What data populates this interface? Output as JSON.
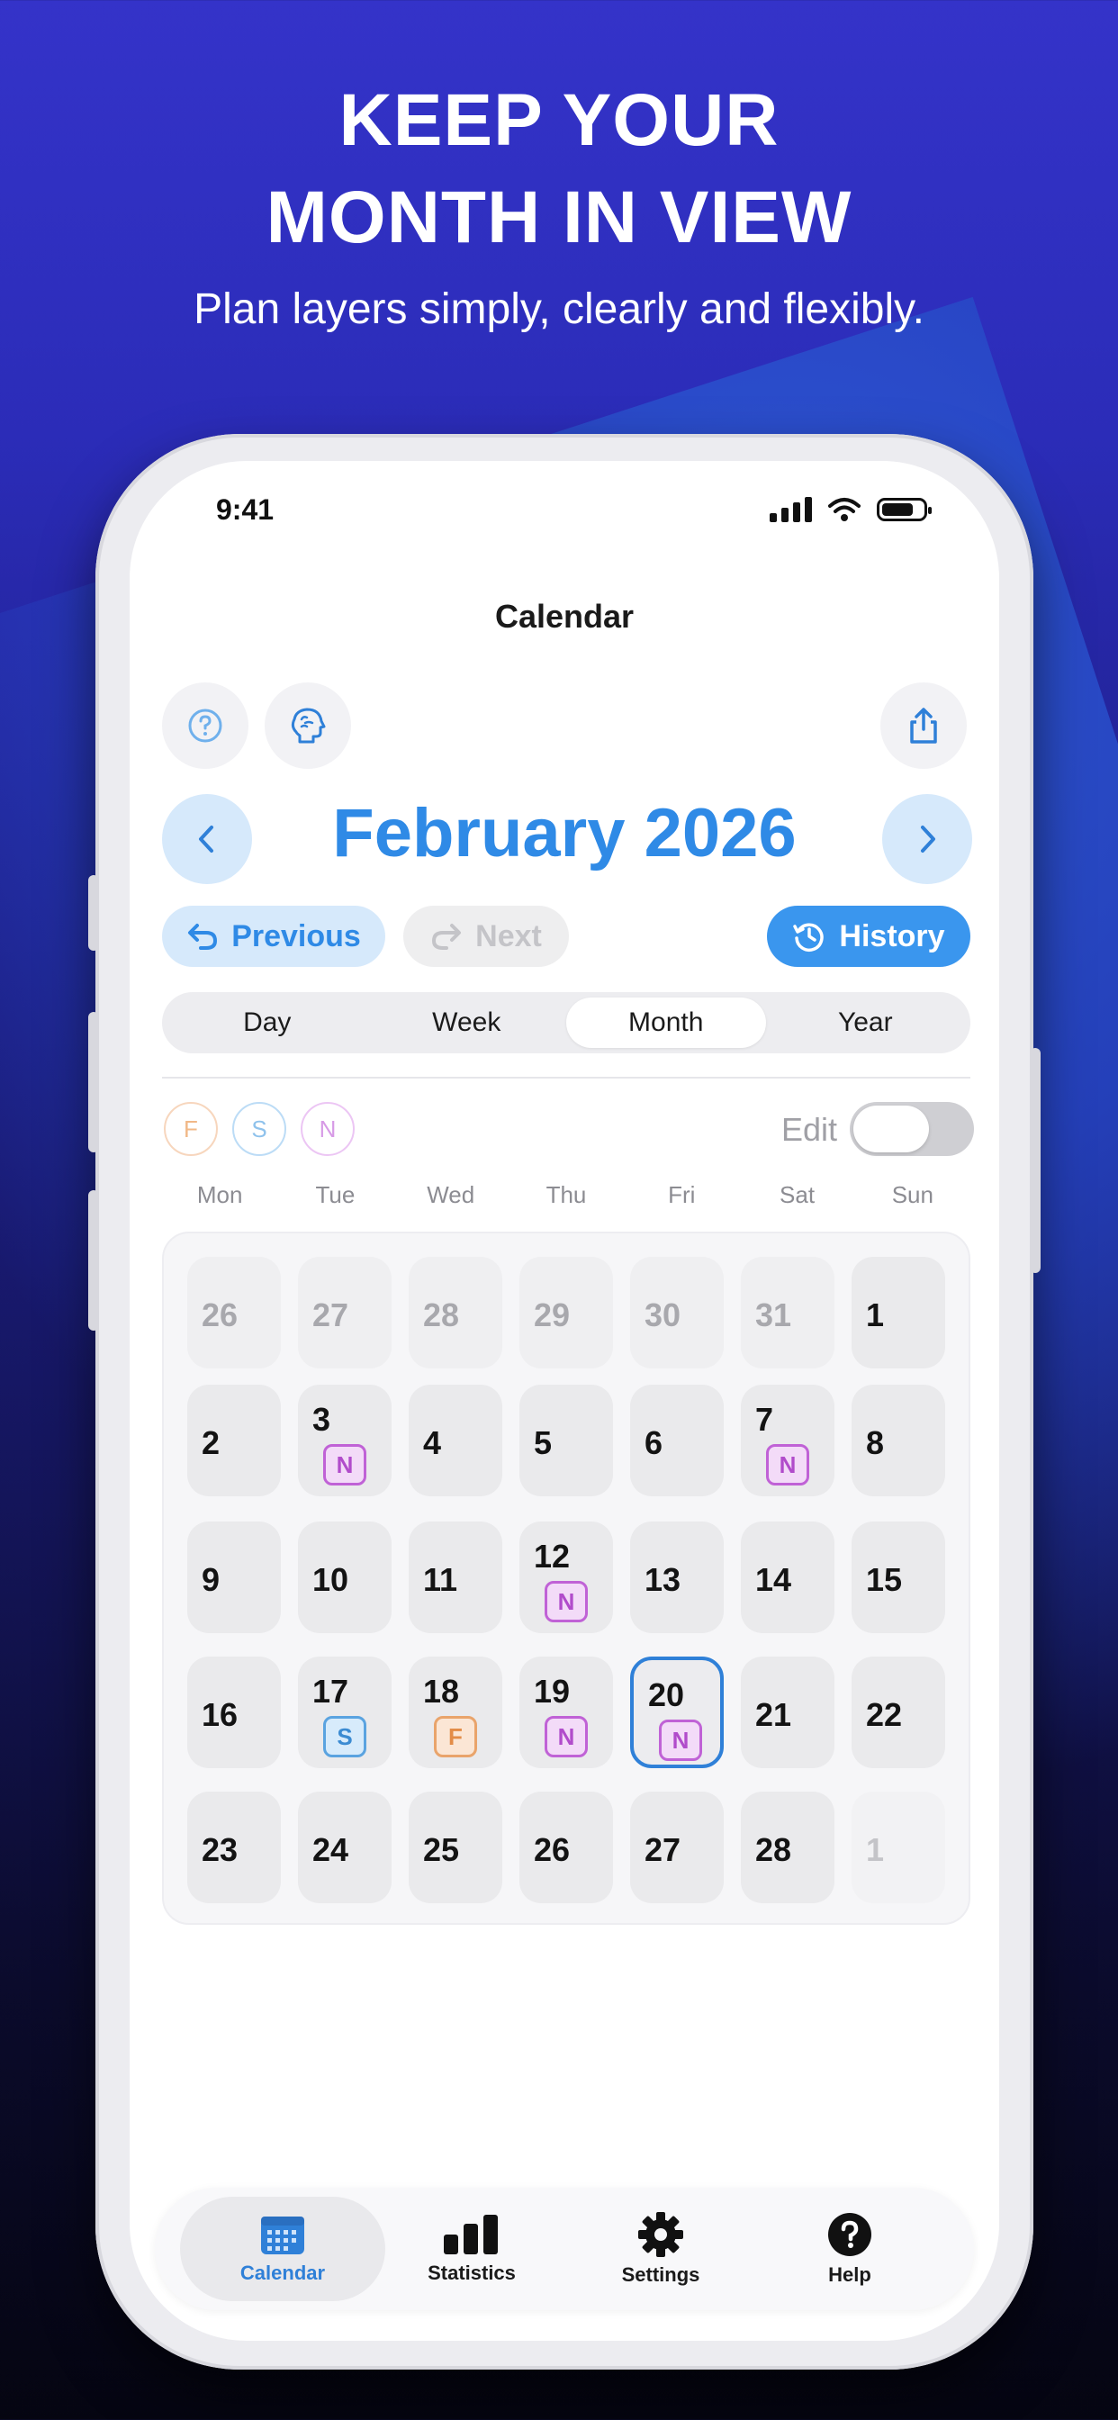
{
  "promo": {
    "headline_line1": "KEEP YOUR",
    "headline_line2": "MONTH IN VIEW",
    "subtitle": "Plan layers simply, clearly and flexibly."
  },
  "status_bar": {
    "time": "9:41"
  },
  "nav": {
    "title": "Calendar"
  },
  "toolbar": {
    "left_icons": [
      "question-icon",
      "brain-icon"
    ],
    "right_icon": "share-icon"
  },
  "month": {
    "title": "February 2026"
  },
  "history_nav": {
    "previous_label": "Previous",
    "next_label": "Next",
    "history_label": "History"
  },
  "view_modes": {
    "items": [
      "Day",
      "Week",
      "Month",
      "Year"
    ],
    "selected": "Month"
  },
  "layers": {
    "chips": [
      {
        "letter": "F",
        "color": "#e9a46b"
      },
      {
        "letter": "S",
        "color": "#5aa3e0"
      },
      {
        "letter": "N",
        "color": "#c062d6"
      }
    ],
    "edit_label": "Edit",
    "edit_on": false
  },
  "weekdays": [
    "Mon",
    "Tue",
    "Wed",
    "Thu",
    "Fri",
    "Sat",
    "Sun"
  ],
  "calendar": {
    "weeks": [
      [
        {
          "d": "26",
          "state": "muted"
        },
        {
          "d": "27",
          "state": "muted"
        },
        {
          "d": "28",
          "state": "muted"
        },
        {
          "d": "29",
          "state": "muted"
        },
        {
          "d": "30",
          "state": "muted"
        },
        {
          "d": "31",
          "state": "muted"
        },
        {
          "d": "1"
        }
      ],
      [
        {
          "d": "2"
        },
        {
          "d": "3",
          "badge": "N"
        },
        {
          "d": "4"
        },
        {
          "d": "5"
        },
        {
          "d": "6"
        },
        {
          "d": "7",
          "badge": "N"
        },
        {
          "d": "8"
        }
      ],
      [
        {
          "d": "9"
        },
        {
          "d": "10"
        },
        {
          "d": "11"
        },
        {
          "d": "12",
          "badge": "N"
        },
        {
          "d": "13"
        },
        {
          "d": "14"
        },
        {
          "d": "15"
        }
      ],
      [
        {
          "d": "16"
        },
        {
          "d": "17",
          "badge": "S"
        },
        {
          "d": "18",
          "badge": "F"
        },
        {
          "d": "19",
          "badge": "N"
        },
        {
          "d": "20",
          "badge": "N",
          "today": true
        },
        {
          "d": "21"
        },
        {
          "d": "22"
        }
      ],
      [
        {
          "d": "23"
        },
        {
          "d": "24"
        },
        {
          "d": "25"
        },
        {
          "d": "26"
        },
        {
          "d": "27"
        },
        {
          "d": "28"
        },
        {
          "d": "1",
          "state": "faint"
        }
      ]
    ]
  },
  "tabbar": {
    "items": [
      {
        "label": "Calendar",
        "icon": "calendar-icon",
        "active": true
      },
      {
        "label": "Statistics",
        "icon": "bar-chart-icon"
      },
      {
        "label": "Settings",
        "icon": "gear-icon"
      },
      {
        "label": "Help",
        "icon": "help-icon"
      }
    ]
  },
  "colors": {
    "accent": "#2f8ae6",
    "accent_light": "#d6e9fb",
    "history_button": "#3a96ee"
  }
}
